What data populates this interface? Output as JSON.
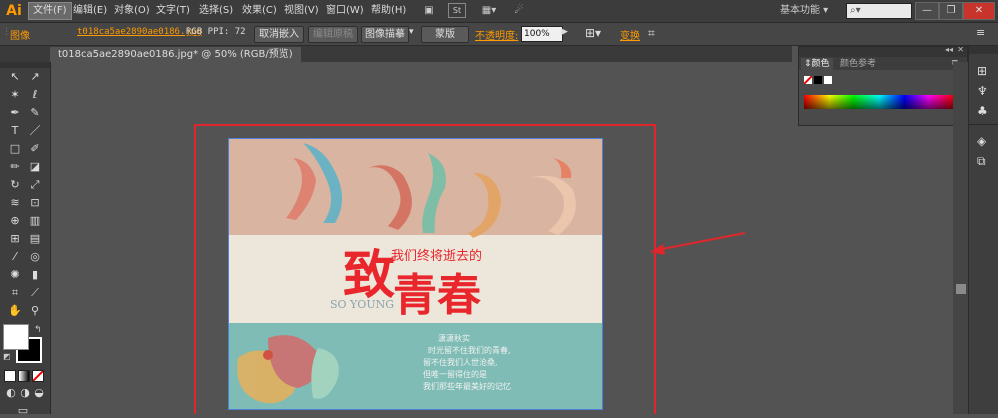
{
  "app": {
    "logo": "Ai"
  },
  "menu": [
    {
      "label": "文件(F)",
      "active": true
    },
    {
      "label": "编辑(E)"
    },
    {
      "label": "对象(O)"
    },
    {
      "label": "文字(T)"
    },
    {
      "label": "选择(S)"
    },
    {
      "label": "效果(C)"
    },
    {
      "label": "视图(V)"
    },
    {
      "label": "窗口(W)"
    },
    {
      "label": "帮助(H)"
    }
  ],
  "topbar": {
    "workspace": "基本功能",
    "st_label": "St",
    "search_placeholder": ""
  },
  "control": {
    "object_type": "图像",
    "filename": "t018ca5ae2890ae0186.jpg",
    "info": "RGB  PPI: 72",
    "embed": "取消嵌入",
    "edit_original": "编辑原稿",
    "image_trace": "图像描摹",
    "mask": "蒙版",
    "opacity_label": "不透明度:",
    "opacity_value": "100%",
    "transform": "变换"
  },
  "document": {
    "tab_title": "t018ca5ae2890ae0186.jpg* @ 50% (RGB/预览)"
  },
  "color_panel": {
    "tab_color": "颜色",
    "tab_guide": "颜色参考"
  },
  "artwork": {
    "headline_big1": "致",
    "headline_big2": "青春",
    "headline_small": "我们终将逝去的",
    "subtitle": "SO YOUNG",
    "poem": [
      "潇潇秋实",
      "时光留不住我们的青春,",
      "留不住我们人世沧桑,",
      "但唯一留得住的是",
      "我们那些年最美好的记忆"
    ]
  },
  "colors": {
    "accent_red": "#e0262b",
    "top_band": "#d8b4a2",
    "mid_band": "#ede6da",
    "bottom_band": "#7fbcb6",
    "headline_red": "#e8262c"
  }
}
